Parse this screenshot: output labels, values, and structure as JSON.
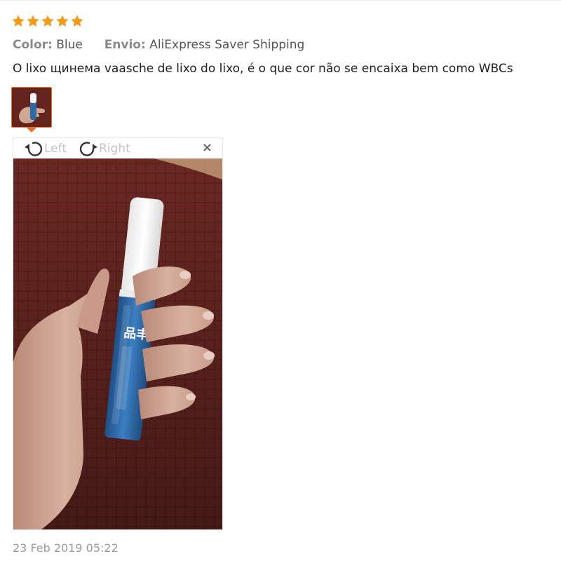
{
  "review": {
    "rating": 5,
    "rating_color": "#f39c1b",
    "attributes": [
      {
        "key": "Color:",
        "value": "Blue"
      },
      {
        "key": "Envio:",
        "value": "AliExpress Saver Shipping"
      }
    ],
    "text": "O lixo щинема vaasche de lixo do lixo, é o que cor não se encaixa bem como WBCs",
    "date": "23 Feb 2019 05:22"
  },
  "viewer": {
    "rotate_left_label": "Left",
    "rotate_right_label": "Right",
    "close_label": "×",
    "accent_color": "#e4732a",
    "icons": [
      "rotate-left-icon",
      "rotate-right-icon",
      "close-icon"
    ]
  }
}
